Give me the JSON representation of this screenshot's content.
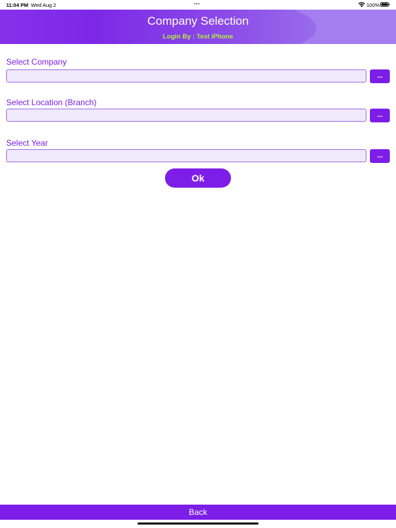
{
  "status_bar": {
    "time": "11:04 PM",
    "date": "Wed Aug 2",
    "battery_percent": "100%"
  },
  "header": {
    "title": "Company Selection",
    "subtitle": "Login By : Test iPhone"
  },
  "form": {
    "company": {
      "label": "Select Company",
      "value": "",
      "button_label": "..."
    },
    "location": {
      "label": "Select Location (Branch)",
      "value": "",
      "button_label": "..."
    },
    "year": {
      "label": "Select Year",
      "value": "",
      "button_label": "..."
    },
    "ok_label": "Ok"
  },
  "footer": {
    "back_label": "Back"
  },
  "colors": {
    "accent": "#7d1ee8",
    "label_text": "#7d1ee0",
    "subtitle_text": "#b6f23a",
    "input_bg": "#f0e9fc"
  }
}
